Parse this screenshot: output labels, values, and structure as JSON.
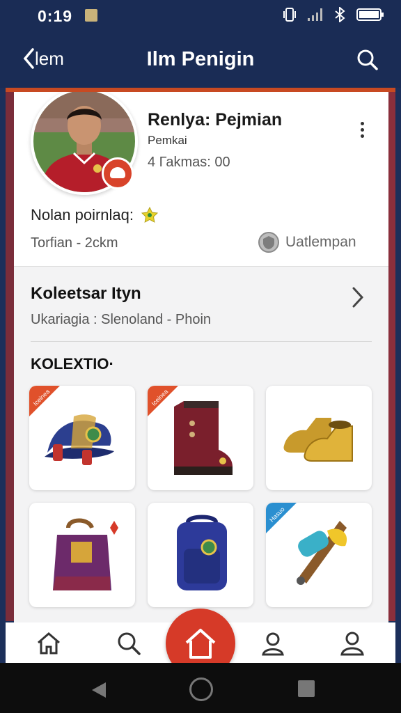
{
  "status_bar": {
    "time": "0:19"
  },
  "app_bar": {
    "back_label": "lem",
    "title": "Ilm Penigin"
  },
  "profile": {
    "name": "Renlya: Pejmian",
    "role": "Pemkai",
    "followers": "4 Гаkmas: 00",
    "level_label": "Nolan poirnlaq:",
    "location": "Torfian - 2ckm",
    "club": "Uatlempan"
  },
  "collection_header": {
    "title": "Koleetsar Ityn",
    "subtitle": "Ukariagia : Slenoland - Phoin"
  },
  "section_label": "KOLEXTIO·",
  "items": [
    {
      "name": "cap",
      "badge": "Iceinea",
      "badge_color": "#e0512b"
    },
    {
      "name": "boot",
      "badge": "Iceinea",
      "badge_color": "#e0512b"
    },
    {
      "name": "golden-shoes",
      "badge": "",
      "badge_color": ""
    },
    {
      "name": "bag",
      "badge": "",
      "badge_color": ""
    },
    {
      "name": "backpack",
      "badge": "",
      "badge_color": ""
    },
    {
      "name": "pen-tool",
      "badge": "Hasuo",
      "badge_color": "#2a8fd0"
    }
  ],
  "colors": {
    "navy": "#1a2c55",
    "accent_red": "#d63a28",
    "maroon": "#7a2d3a"
  }
}
